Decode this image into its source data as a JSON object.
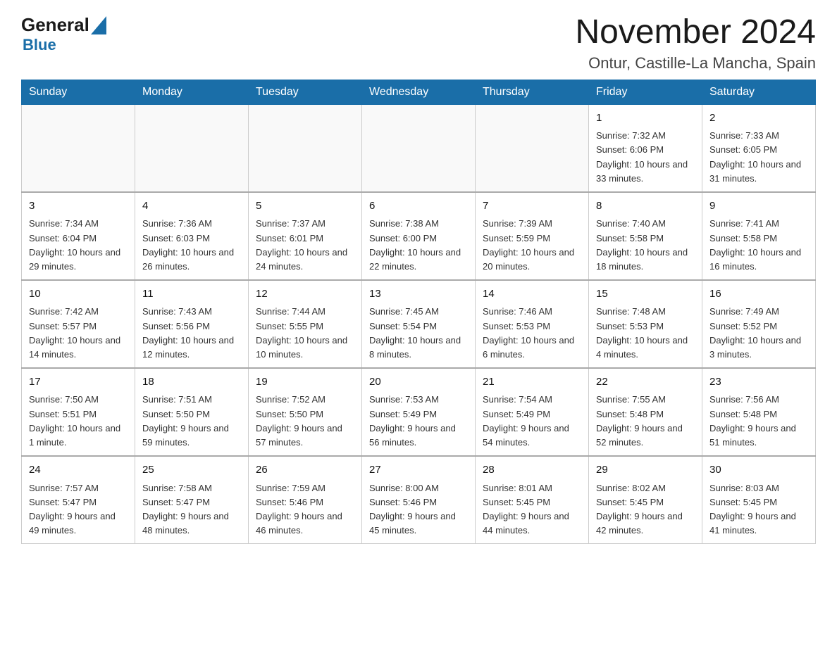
{
  "header": {
    "logo_general": "General",
    "logo_blue": "Blue",
    "month_title": "November 2024",
    "subtitle": "Ontur, Castille-La Mancha, Spain"
  },
  "days_of_week": [
    "Sunday",
    "Monday",
    "Tuesday",
    "Wednesday",
    "Thursday",
    "Friday",
    "Saturday"
  ],
  "weeks": [
    [
      {
        "day": "",
        "info": ""
      },
      {
        "day": "",
        "info": ""
      },
      {
        "day": "",
        "info": ""
      },
      {
        "day": "",
        "info": ""
      },
      {
        "day": "",
        "info": ""
      },
      {
        "day": "1",
        "info": "Sunrise: 7:32 AM\nSunset: 6:06 PM\nDaylight: 10 hours and 33 minutes."
      },
      {
        "day": "2",
        "info": "Sunrise: 7:33 AM\nSunset: 6:05 PM\nDaylight: 10 hours and 31 minutes."
      }
    ],
    [
      {
        "day": "3",
        "info": "Sunrise: 7:34 AM\nSunset: 6:04 PM\nDaylight: 10 hours and 29 minutes."
      },
      {
        "day": "4",
        "info": "Sunrise: 7:36 AM\nSunset: 6:03 PM\nDaylight: 10 hours and 26 minutes."
      },
      {
        "day": "5",
        "info": "Sunrise: 7:37 AM\nSunset: 6:01 PM\nDaylight: 10 hours and 24 minutes."
      },
      {
        "day": "6",
        "info": "Sunrise: 7:38 AM\nSunset: 6:00 PM\nDaylight: 10 hours and 22 minutes."
      },
      {
        "day": "7",
        "info": "Sunrise: 7:39 AM\nSunset: 5:59 PM\nDaylight: 10 hours and 20 minutes."
      },
      {
        "day": "8",
        "info": "Sunrise: 7:40 AM\nSunset: 5:58 PM\nDaylight: 10 hours and 18 minutes."
      },
      {
        "day": "9",
        "info": "Sunrise: 7:41 AM\nSunset: 5:58 PM\nDaylight: 10 hours and 16 minutes."
      }
    ],
    [
      {
        "day": "10",
        "info": "Sunrise: 7:42 AM\nSunset: 5:57 PM\nDaylight: 10 hours and 14 minutes."
      },
      {
        "day": "11",
        "info": "Sunrise: 7:43 AM\nSunset: 5:56 PM\nDaylight: 10 hours and 12 minutes."
      },
      {
        "day": "12",
        "info": "Sunrise: 7:44 AM\nSunset: 5:55 PM\nDaylight: 10 hours and 10 minutes."
      },
      {
        "day": "13",
        "info": "Sunrise: 7:45 AM\nSunset: 5:54 PM\nDaylight: 10 hours and 8 minutes."
      },
      {
        "day": "14",
        "info": "Sunrise: 7:46 AM\nSunset: 5:53 PM\nDaylight: 10 hours and 6 minutes."
      },
      {
        "day": "15",
        "info": "Sunrise: 7:48 AM\nSunset: 5:53 PM\nDaylight: 10 hours and 4 minutes."
      },
      {
        "day": "16",
        "info": "Sunrise: 7:49 AM\nSunset: 5:52 PM\nDaylight: 10 hours and 3 minutes."
      }
    ],
    [
      {
        "day": "17",
        "info": "Sunrise: 7:50 AM\nSunset: 5:51 PM\nDaylight: 10 hours and 1 minute."
      },
      {
        "day": "18",
        "info": "Sunrise: 7:51 AM\nSunset: 5:50 PM\nDaylight: 9 hours and 59 minutes."
      },
      {
        "day": "19",
        "info": "Sunrise: 7:52 AM\nSunset: 5:50 PM\nDaylight: 9 hours and 57 minutes."
      },
      {
        "day": "20",
        "info": "Sunrise: 7:53 AM\nSunset: 5:49 PM\nDaylight: 9 hours and 56 minutes."
      },
      {
        "day": "21",
        "info": "Sunrise: 7:54 AM\nSunset: 5:49 PM\nDaylight: 9 hours and 54 minutes."
      },
      {
        "day": "22",
        "info": "Sunrise: 7:55 AM\nSunset: 5:48 PM\nDaylight: 9 hours and 52 minutes."
      },
      {
        "day": "23",
        "info": "Sunrise: 7:56 AM\nSunset: 5:48 PM\nDaylight: 9 hours and 51 minutes."
      }
    ],
    [
      {
        "day": "24",
        "info": "Sunrise: 7:57 AM\nSunset: 5:47 PM\nDaylight: 9 hours and 49 minutes."
      },
      {
        "day": "25",
        "info": "Sunrise: 7:58 AM\nSunset: 5:47 PM\nDaylight: 9 hours and 48 minutes."
      },
      {
        "day": "26",
        "info": "Sunrise: 7:59 AM\nSunset: 5:46 PM\nDaylight: 9 hours and 46 minutes."
      },
      {
        "day": "27",
        "info": "Sunrise: 8:00 AM\nSunset: 5:46 PM\nDaylight: 9 hours and 45 minutes."
      },
      {
        "day": "28",
        "info": "Sunrise: 8:01 AM\nSunset: 5:45 PM\nDaylight: 9 hours and 44 minutes."
      },
      {
        "day": "29",
        "info": "Sunrise: 8:02 AM\nSunset: 5:45 PM\nDaylight: 9 hours and 42 minutes."
      },
      {
        "day": "30",
        "info": "Sunrise: 8:03 AM\nSunset: 5:45 PM\nDaylight: 9 hours and 41 minutes."
      }
    ]
  ]
}
